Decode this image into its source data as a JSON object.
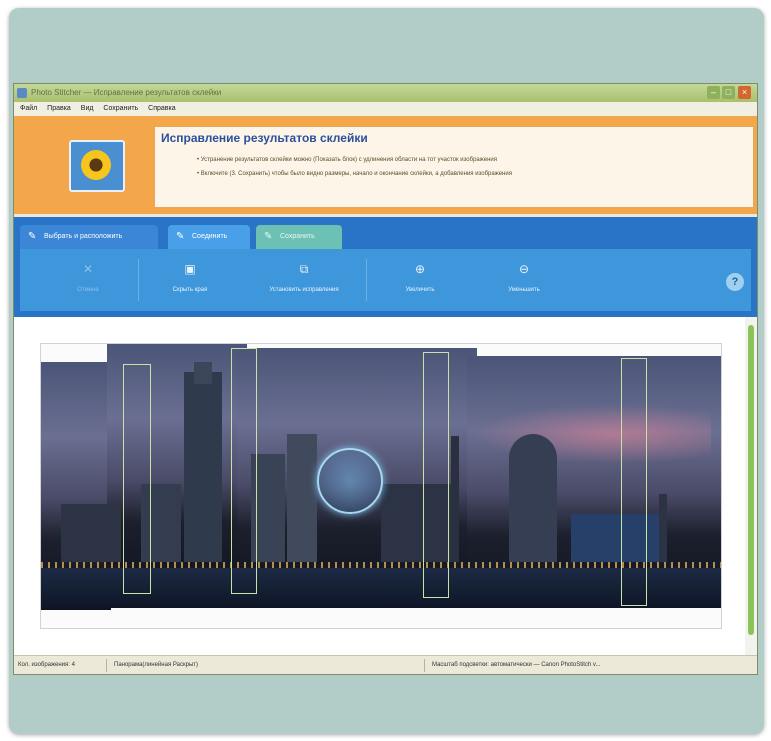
{
  "window": {
    "title": "Photo Stitcher — Исправление результатов склейки",
    "menu": [
      "Файл",
      "Правка",
      "Вид",
      "Сохранить",
      "Справка"
    ]
  },
  "banner": {
    "title": "Исправление результатов склейки",
    "line1": "• Устранение результатов склейки можно (Показать блок) с удлинения области на тот участок изображения",
    "line2": "• Включите (3. Сохранить) чтобы было видно размеры, начало и окончание склейки, а добавления изображения"
  },
  "tabs": [
    {
      "label": "Выбрать и расположить"
    },
    {
      "label": "Соединить"
    },
    {
      "label": "Сохранить"
    }
  ],
  "toolbar": {
    "buttons": [
      {
        "label": "Отмена"
      },
      {
        "label": "Скрыть края"
      },
      {
        "label": "Установить исправления"
      },
      {
        "label": "Увеличить"
      },
      {
        "label": "Уменьшить"
      }
    ],
    "help": "?"
  },
  "statusbar": {
    "left": "Кол. изображения: 4",
    "middle": "Панорама(линейная Раскрыт)",
    "right": "Масштаб подсветки: автоматически — Canon PhotoStitch v..."
  },
  "colors": {
    "frame": "#b2ccc7",
    "banner": "#f4a64a",
    "toolbar_blue": "#2a74c7",
    "title_blue": "#2b4f9e",
    "seam_green": "#c7e3a8"
  },
  "icons": {
    "cancel": "x-icon",
    "hide_edges": "edges-icon",
    "apply": "apply-icon",
    "zoom_in": "zoom-in-icon",
    "zoom_out": "zoom-out-icon",
    "help": "help-icon"
  }
}
